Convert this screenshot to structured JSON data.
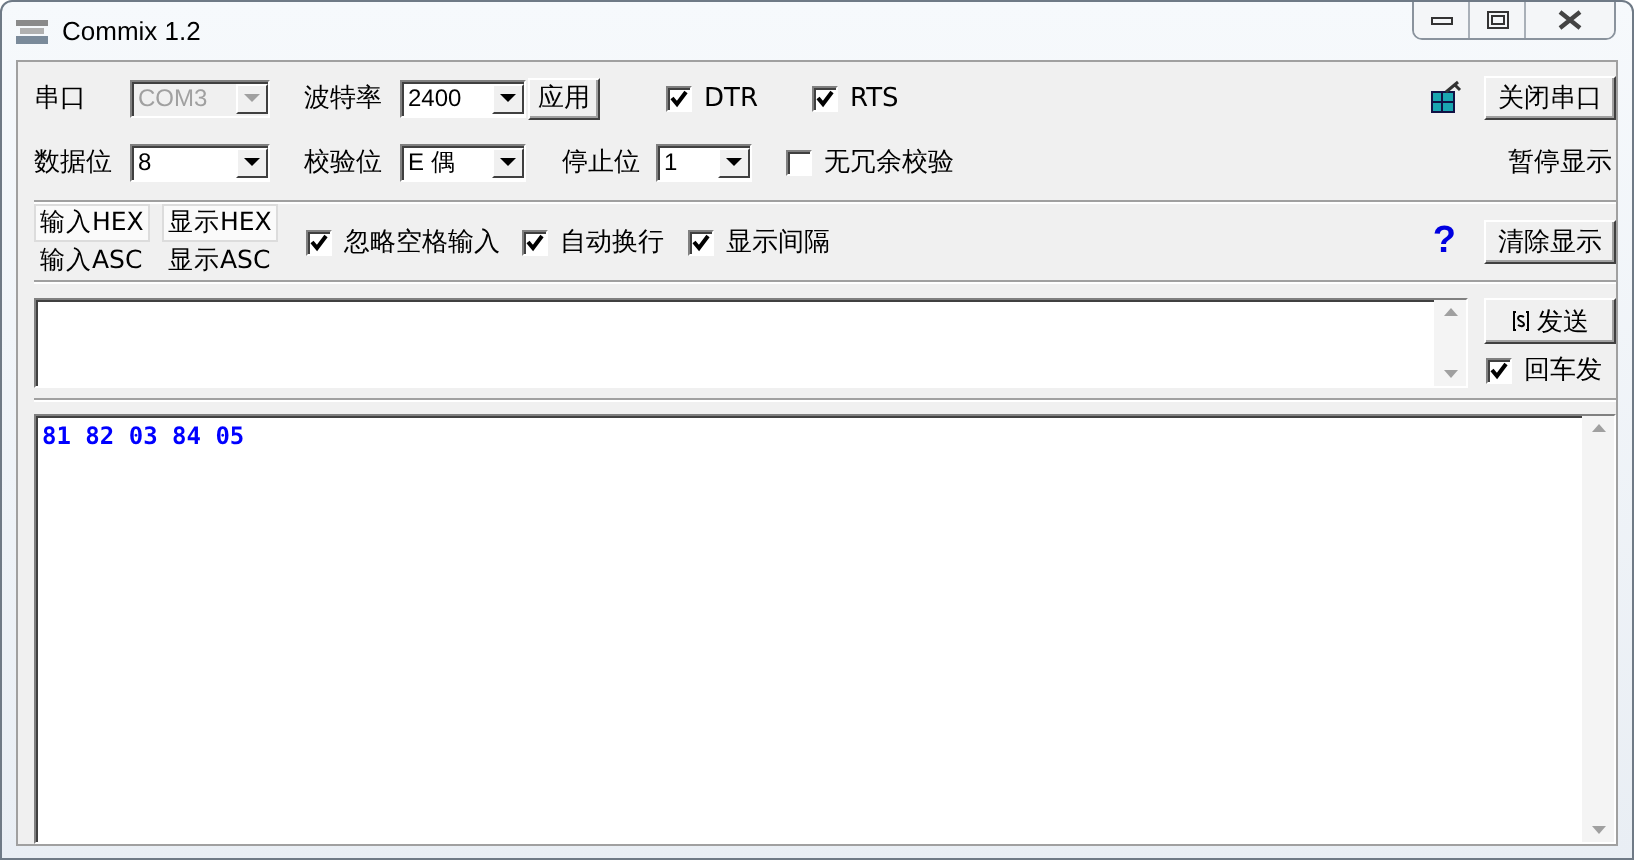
{
  "window": {
    "title": "Commix 1.2"
  },
  "serial": {
    "port_label": "串口",
    "port": {
      "value": "COM3",
      "disabled": true
    },
    "baud_label": "波特率",
    "baud": {
      "value": "2400",
      "disabled": false
    },
    "apply_button": "应用",
    "data_bits_label": "数据位",
    "data_bits": {
      "value": "8",
      "disabled": false
    },
    "parity_label": "校验位",
    "parity": {
      "value": "E 偶",
      "disabled": false
    },
    "stop_bits_label": "停止位",
    "stop_bits": {
      "value": "1",
      "disabled": false
    }
  },
  "options": [
    {
      "label": "DTR",
      "checked": true
    },
    {
      "label": "RTS",
      "checked": true
    },
    {
      "label": "无冗余校验",
      "checked": false
    }
  ],
  "close_port_button": "关闭串口",
  "pause_label": "暂停显示",
  "input_mode": [
    {
      "label": "输入HEX",
      "selected": true
    },
    {
      "label": "输入ASC",
      "selected": false
    }
  ],
  "display_mode": [
    {
      "label": "显示HEX",
      "selected": true
    },
    {
      "label": "显示ASC",
      "selected": false
    }
  ],
  "display_options": [
    {
      "label": "忽略空格输入",
      "checked": true
    },
    {
      "label": "自动换行",
      "checked": true
    },
    {
      "label": "显示间隔",
      "checked": true
    }
  ],
  "help": "?",
  "clear_button": "清除显示",
  "send_button": "发送",
  "send_on_enter": {
    "label": "回车发",
    "checked": true
  },
  "output": "81 82 03 84 05"
}
